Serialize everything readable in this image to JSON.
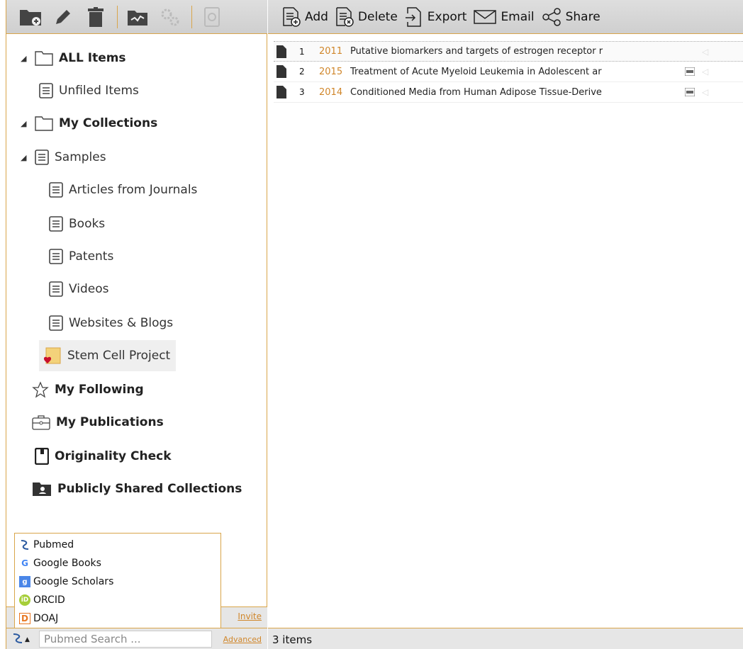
{
  "tree": {
    "all_items": "ALL Items",
    "unfiled": "Unfiled Items",
    "my_collections": "My Collections",
    "samples": "Samples",
    "articles": "Articles from Journals",
    "books": "Books",
    "patents": "Patents",
    "videos": "Videos",
    "websites": "Websites & Blogs",
    "stem_cell": "Stem Cell Project",
    "my_following": "My Following",
    "my_publications": "My Publications",
    "originality": "Originality Check",
    "public_shared": "Publicly Shared Collections"
  },
  "sources": {
    "items": [
      "Pubmed",
      "Google Books",
      "Google Scholars",
      "ORCID",
      "DOAJ"
    ]
  },
  "left_footer": {
    "invite": "Invite",
    "search_placeholder": "Pubmed Search ...",
    "advanced": "Advanced"
  },
  "toolbar": {
    "add": "Add",
    "delete": "Delete",
    "export": "Export",
    "email": "Email",
    "share": "Share"
  },
  "items": [
    {
      "num": "1",
      "year": "2011",
      "title": "Putative biomarkers and targets of estrogen receptor r"
    },
    {
      "num": "2",
      "year": "2015",
      "title": "Treatment of Acute Myeloid Leukemia in Adolescent ar"
    },
    {
      "num": "3",
      "year": "2014",
      "title": "Conditioned Media from Human Adipose Tissue-Derive"
    }
  ],
  "status": {
    "count": "3 items"
  },
  "colors": {
    "accent": "#d9a54a",
    "year": "#d0862a"
  }
}
